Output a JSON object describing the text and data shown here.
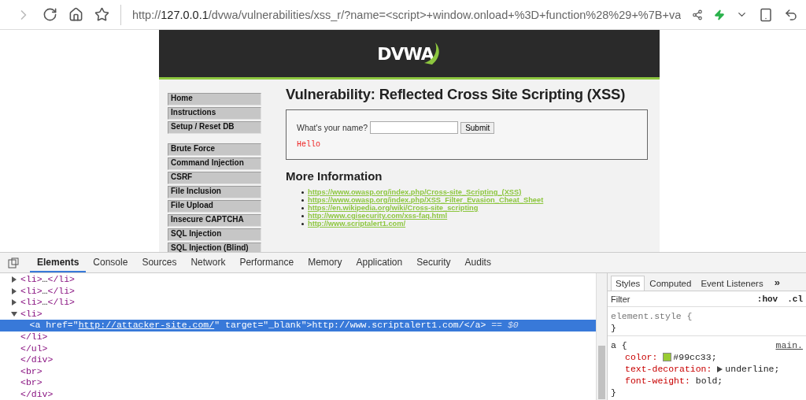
{
  "browser": {
    "url": {
      "scheme": "http://",
      "host": "127.0.0.1",
      "path": "/dvwa/vulnerabilities/xss_r/?name=<script>+window.onload+%3D+function%28%29+%7B+va"
    }
  },
  "page": {
    "logo": "DVWA",
    "menu": [
      {
        "items": [
          "Home",
          "Instructions",
          "Setup / Reset DB"
        ]
      },
      {
        "items": [
          "Brute Force",
          "Command Injection",
          "CSRF",
          "File Inclusion",
          "File Upload",
          "Insecure CAPTCHA",
          "SQL Injection",
          "SQL Injection (Blind)"
        ]
      }
    ],
    "title": "Vulnerability: Reflected Cross Site Scripting (XSS)",
    "form": {
      "label": "What's your name?",
      "button": "Submit",
      "output": "Hello"
    },
    "more_heading": "More Information",
    "links": [
      "https://www.owasp.org/index.php/Cross-site_Scripting_(XSS)",
      "https://www.owasp.org/index.php/XSS_Filter_Evasion_Cheat_Sheet",
      "https://en.wikipedia.org/wiki/Cross-site_scripting",
      "http://www.cgisecurity.com/xss-faq.html",
      "http://www.scriptalert1.com/"
    ]
  },
  "devtools": {
    "tabs": [
      {
        "label": "Elements",
        "selected": true
      },
      {
        "label": "Console",
        "selected": false
      },
      {
        "label": "Sources",
        "selected": false
      },
      {
        "label": "Network",
        "selected": false
      },
      {
        "label": "Performance",
        "selected": false
      },
      {
        "label": "Memory",
        "selected": false
      },
      {
        "label": "Application",
        "selected": false
      },
      {
        "label": "Security",
        "selected": false
      },
      {
        "label": "Audits",
        "selected": false
      }
    ],
    "dom": [
      {
        "children": [
          {
            "children": [
              {
                "children": [
                  {
                    "expanded": false,
                    "selected": false,
                    "parts": [
                      {
                        "kind": "tag",
                        "text": "<li>"
                      },
                      {
                        "kind": "text",
                        "text": "…"
                      },
                      {
                        "kind": "tag",
                        "text": "</li>"
                      }
                    ]
                  },
                  {
                    "expanded": false,
                    "selected": false,
                    "parts": [
                      {
                        "kind": "tag",
                        "text": "<li>"
                      },
                      {
                        "kind": "text",
                        "text": "…"
                      },
                      {
                        "kind": "tag",
                        "text": "</li>"
                      }
                    ]
                  },
                  {
                    "expanded": false,
                    "selected": false,
                    "parts": [
                      {
                        "kind": "tag",
                        "text": "<li>"
                      },
                      {
                        "kind": "text",
                        "text": "…"
                      },
                      {
                        "kind": "tag",
                        "text": "</li>"
                      }
                    ]
                  },
                  {
                    "expanded": true,
                    "selected": false,
                    "parts": [
                      {
                        "kind": "tag",
                        "text": "<li>"
                      }
                    ],
                    "children": [
                      {
                        "selected": true,
                        "parts": [
                          {
                            "kind": "tag",
                            "text": "<a"
                          },
                          {
                            "kind": "attr",
                            "text": " href"
                          },
                          {
                            "kind": "tag",
                            "text": "=\""
                          },
                          {
                            "kind": "link",
                            "text": "http://attacker-site.com/"
                          },
                          {
                            "kind": "tag",
                            "text": "\""
                          },
                          {
                            "kind": "attr",
                            "text": " target"
                          },
                          {
                            "kind": "tag",
                            "text": "=\""
                          },
                          {
                            "kind": "value",
                            "text": "_blank"
                          },
                          {
                            "kind": "tag",
                            "text": "\">"
                          },
                          {
                            "kind": "text",
                            "text": "http://www.scriptalert1.com/"
                          },
                          {
                            "kind": "tag",
                            "text": "</a>"
                          },
                          {
                            "kind": "ref",
                            "text": " == $0"
                          }
                        ]
                      }
                    ]
                  },
                  {
                    "selected": false,
                    "parts": [
                      {
                        "kind": "tag",
                        "text": "</li>"
                      }
                    ]
                  }
                ]
              },
              {
                "selected": false,
                "parts": [
                  {
                    "kind": "tag",
                    "text": "</ul>"
                  }
                ]
              }
            ]
          },
          {
            "selected": false,
            "parts": [
              {
                "kind": "tag",
                "text": "</div>"
              }
            ]
          },
          {
            "selected": false,
            "parts": [
              {
                "kind": "tag",
                "text": "<br>"
              }
            ]
          },
          {
            "selected": false,
            "parts": [
              {
                "kind": "tag",
                "text": "<br>"
              }
            ]
          }
        ]
      },
      {
        "selected": false,
        "parts": [
          {
            "kind": "tag",
            "text": "</div>"
          }
        ]
      }
    ],
    "styles": {
      "tabs": [
        {
          "label": "Styles",
          "selected": true
        },
        {
          "label": "Computed",
          "selected": false
        },
        {
          "label": "Event Listeners",
          "selected": false
        }
      ],
      "more": "»",
      "filter_placeholder": "Filter",
      "hov": ":hov",
      "cls": ".cl",
      "rules": [
        {
          "selector": "element.style {",
          "kind": "inline",
          "close": "}"
        },
        {
          "selector": "a {",
          "kind": "sheet",
          "source": "main.",
          "close": "}",
          "properties": [
            {
              "name": "color:",
              "value": "#99cc33;",
              "color": "#99cc33"
            },
            {
              "name": "text-decoration:",
              "value": "underline;",
              "expandable": true
            },
            {
              "name": "font-weight:",
              "value": "bold;"
            }
          ]
        }
      ]
    }
  }
}
